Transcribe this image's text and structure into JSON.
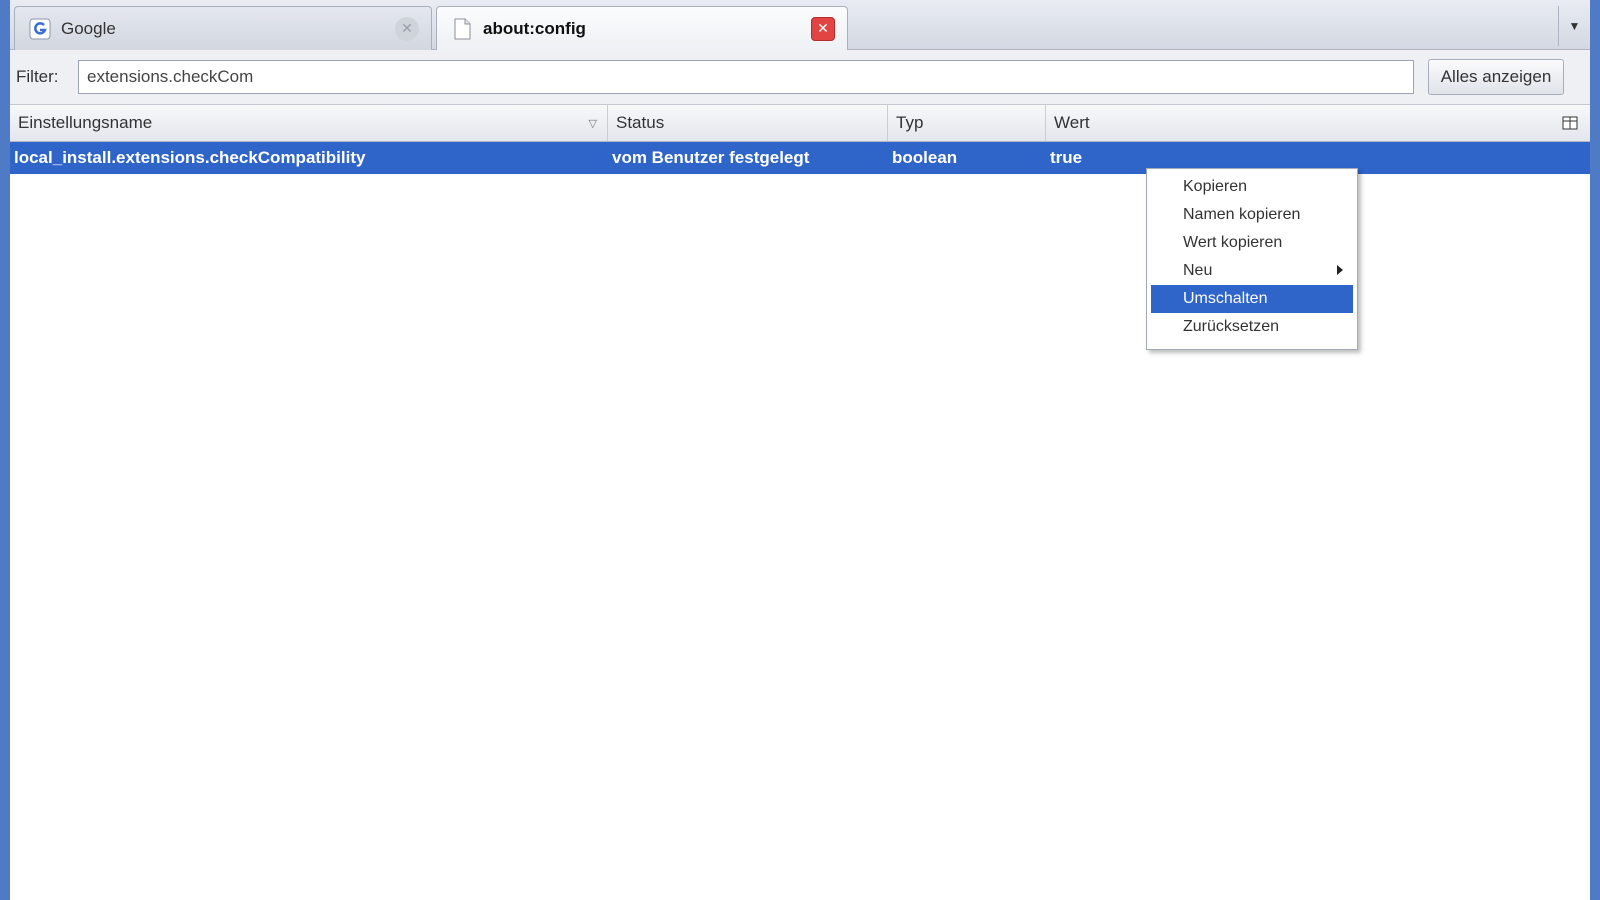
{
  "tabs": [
    {
      "title": "Google",
      "favicon": "google-g-icon",
      "active": false
    },
    {
      "title": "about:config",
      "favicon": "page-icon",
      "active": true
    }
  ],
  "filter": {
    "label": "Filter:",
    "value": "extensions.checkCom",
    "show_all_label": "Alles anzeigen"
  },
  "columns": {
    "name": "Einstellungsname",
    "status": "Status",
    "type": "Typ",
    "value": "Wert"
  },
  "rows": [
    {
      "name": "local_install.extensions.checkCompatibility",
      "status": "vom Benutzer festgelegt",
      "type": "boolean",
      "value": "true"
    }
  ],
  "context_menu": {
    "items": [
      {
        "label": "Kopieren"
      },
      {
        "label": "Namen kopieren"
      },
      {
        "label": "Wert kopieren"
      },
      {
        "label": "Neu",
        "submenu": true
      },
      {
        "label": "Umschalten",
        "highlighted": true
      },
      {
        "label": "Zurücksetzen"
      }
    ]
  },
  "colors": {
    "selection": "#2f64c9",
    "frame": "#4e7ac6",
    "close_active": "#e24444"
  }
}
